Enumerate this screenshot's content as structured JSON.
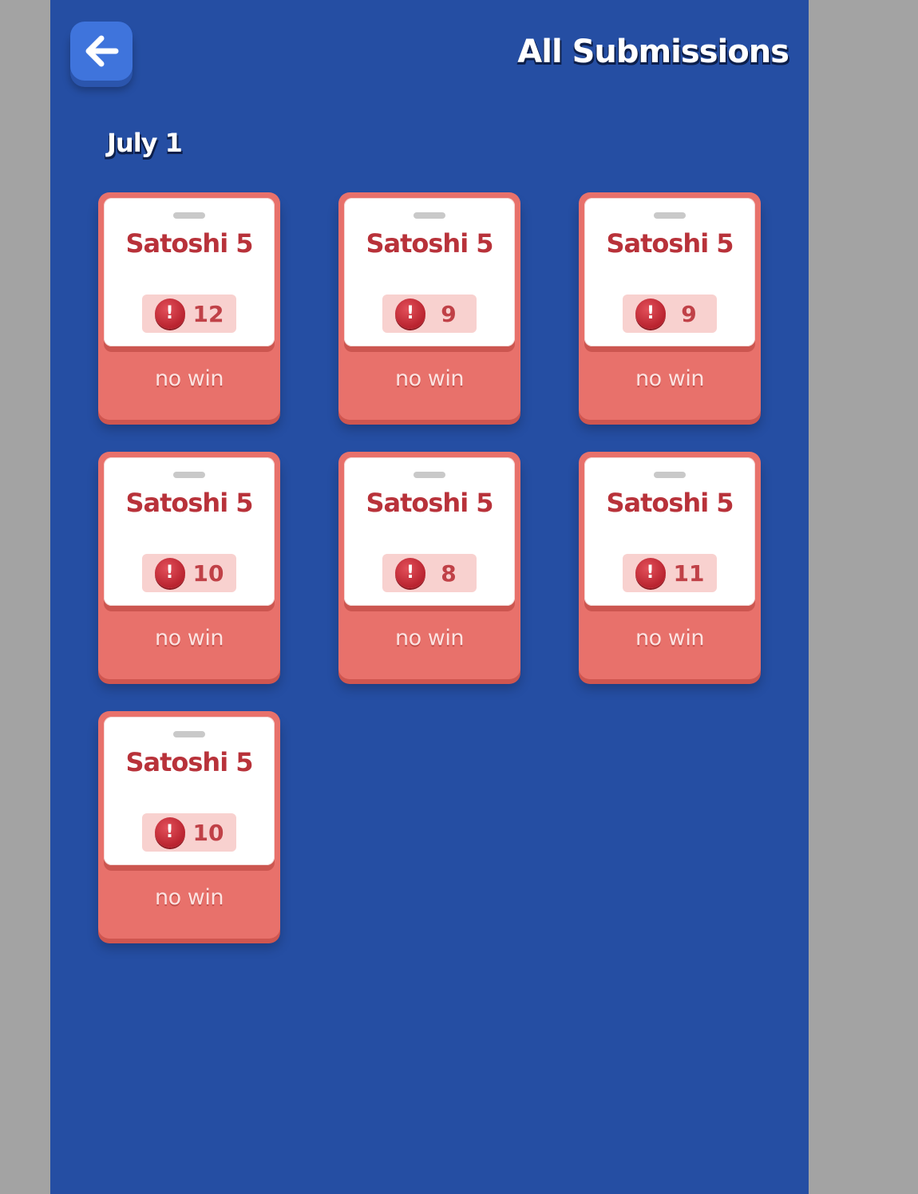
{
  "header": {
    "title": "All Submissions",
    "back_icon": "arrow-left-icon"
  },
  "sections": [
    {
      "date": "July 1",
      "cards": [
        {
          "title": "Satoshi 5",
          "count": "12",
          "result": "no win"
        },
        {
          "title": "Satoshi 5",
          "count": "9",
          "result": "no win"
        },
        {
          "title": "Satoshi 5",
          "count": "9",
          "result": "no win"
        },
        {
          "title": "Satoshi 5",
          "count": "10",
          "result": "no win"
        },
        {
          "title": "Satoshi 5",
          "count": "8",
          "result": "no win"
        },
        {
          "title": "Satoshi 5",
          "count": "11",
          "result": "no win"
        },
        {
          "title": "Satoshi 5",
          "count": "10",
          "result": "no win"
        }
      ]
    }
  ],
  "colors": {
    "background": "#254ea3",
    "side_gutter": "#a3a3a3",
    "card": "#e8716b",
    "card_title": "#b8323a",
    "back_button": "#3f74dc"
  }
}
